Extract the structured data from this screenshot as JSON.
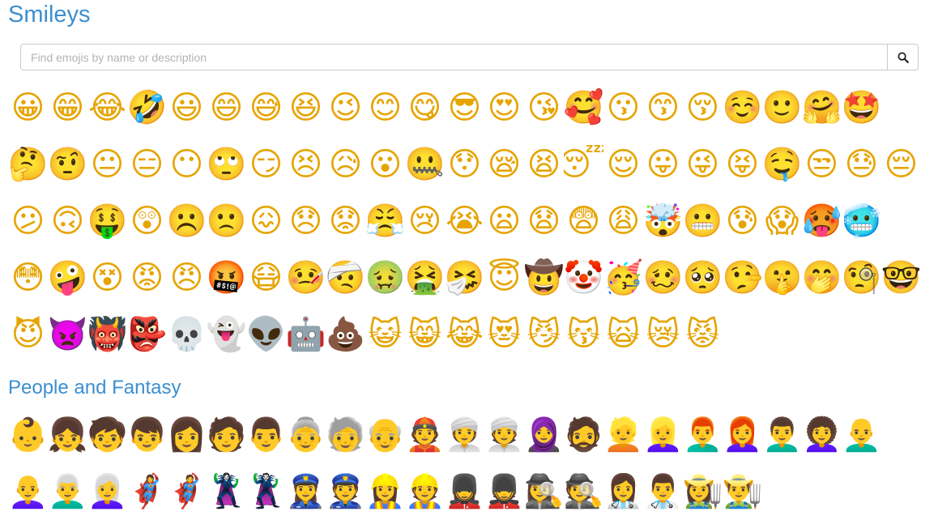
{
  "sections": {
    "smileys": {
      "title": "Smileys"
    },
    "people": {
      "title": "People and Fantasy"
    }
  },
  "search": {
    "placeholder": "Find emojis by name or description",
    "value": "",
    "icon": "search-icon"
  },
  "colors": {
    "heading": "#3b8fd0",
    "border": "#c9c9c9",
    "placeholder": "#b3b3b3"
  },
  "smiley_rows": [
    [
      "😀",
      "😁",
      "😂",
      "🤣",
      "😃",
      "😄",
      "😅",
      "😆",
      "😉",
      "😊",
      "😋",
      "😎",
      "😍",
      "😘",
      "🥰",
      "😗",
      "😙",
      "😚",
      "☺️",
      "🙂",
      "🤗",
      "🤩"
    ],
    [
      "🤔",
      "🤨",
      "😐",
      "😑",
      "😶",
      "🙄",
      "😏",
      "😣",
      "😥",
      "😮",
      "🤐",
      "😯",
      "😪",
      "😫",
      "😴",
      "😌",
      "😛",
      "😜",
      "😝",
      "🤤",
      "😒",
      "😓",
      "😔"
    ],
    [
      "😕",
      "🙃",
      "🤑",
      "😲",
      "☹️",
      "🙁",
      "😖",
      "😞",
      "😟",
      "😤",
      "😢",
      "😭",
      "😦",
      "😧",
      "😨",
      "😩",
      "🤯",
      "😬",
      "😰",
      "😱",
      "🥵",
      "🥶"
    ],
    [
      "😳",
      "🤪",
      "😵",
      "😡",
      "😠",
      "🤬",
      "😷",
      "🤒",
      "🤕",
      "🤢",
      "🤮",
      "🤧",
      "😇",
      "🤠",
      "🤡",
      "🥳",
      "🥴",
      "🥺",
      "🤥",
      "🤫",
      "🤭",
      "🧐",
      "🤓"
    ],
    [
      "😈",
      "👿",
      "👹",
      "👺",
      "💀",
      "👻",
      "👽",
      "🤖",
      "💩",
      "😺",
      "😸",
      "😹",
      "😻",
      "😼",
      "😽",
      "🙀",
      "😿",
      "😾"
    ]
  ],
  "people_rows": [
    [
      "👶",
      "👧",
      "🧒",
      "👦",
      "👩",
      "🧑",
      "👨",
      "👵",
      "🧓",
      "👴",
      "👲",
      "👳‍♀️",
      "👳",
      "🧕",
      "🧔",
      "👱",
      "👱‍♀️",
      "👨‍🦰",
      "👩‍🦰",
      "👨‍🦱",
      "👩‍🦱",
      "👨‍🦲"
    ],
    [
      "👩‍🦲",
      "👨‍🦳",
      "👩‍🦳",
      "🦸‍♀️",
      "🦸",
      "🦹‍♀️",
      "🦹",
      "👮‍♀️",
      "👮",
      "👷‍♀️",
      "👷",
      "💂‍♀️",
      "💂",
      "🕵️‍♀️",
      "🕵️",
      "👩‍⚕️",
      "👨‍⚕️",
      "👩‍🌾",
      "👨‍🌾"
    ]
  ]
}
